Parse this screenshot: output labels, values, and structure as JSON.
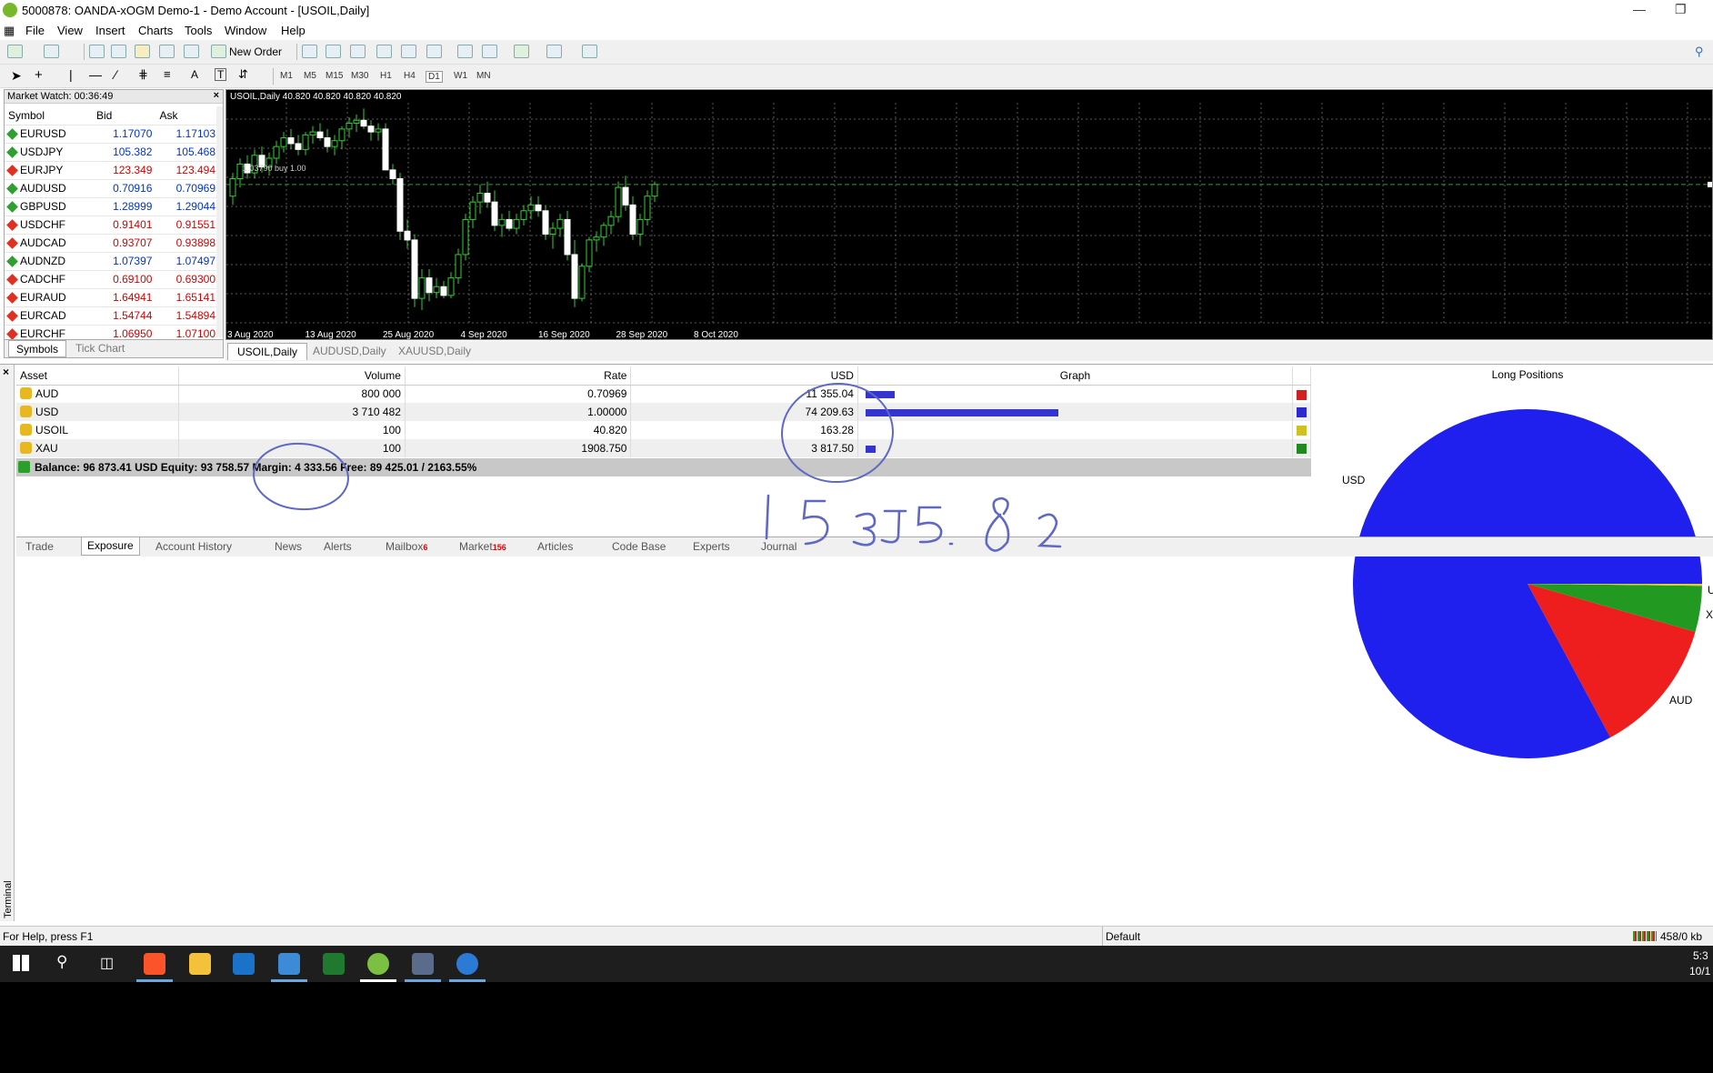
{
  "window": {
    "title": "5000878: OANDA-xOGM Demo-1 - Demo Account - [USOIL,Daily]"
  },
  "menu": [
    "File",
    "View",
    "Insert",
    "Charts",
    "Tools",
    "Window",
    "Help"
  ],
  "toolbar": {
    "new_order": "New Order",
    "timeframes": [
      "M1",
      "M5",
      "M15",
      "M30",
      "H1",
      "H4",
      "D1",
      "W1",
      "MN"
    ]
  },
  "market_watch": {
    "header": "Market Watch: 00:36:49",
    "columns": [
      "Symbol",
      "Bid",
      "Ask"
    ],
    "rows": [
      {
        "symbol": "EURUSD",
        "bid": "1.17070",
        "ask": "1.17103",
        "dir": "up"
      },
      {
        "symbol": "USDJPY",
        "bid": "105.382",
        "ask": "105.468",
        "dir": "up"
      },
      {
        "symbol": "EURJPY",
        "bid": "123.349",
        "ask": "123.494",
        "dir": "down"
      },
      {
        "symbol": "AUDUSD",
        "bid": "0.70916",
        "ask": "0.70969",
        "dir": "up"
      },
      {
        "symbol": "GBPUSD",
        "bid": "1.28999",
        "ask": "1.29044",
        "dir": "up"
      },
      {
        "symbol": "USDCHF",
        "bid": "0.91401",
        "ask": "0.91551",
        "dir": "down"
      },
      {
        "symbol": "AUDCAD",
        "bid": "0.93707",
        "ask": "0.93898",
        "dir": "down"
      },
      {
        "symbol": "AUDNZD",
        "bid": "1.07397",
        "ask": "1.07497",
        "dir": "up"
      },
      {
        "symbol": "CADCHF",
        "bid": "0.69100",
        "ask": "0.69300",
        "dir": "down"
      },
      {
        "symbol": "EURAUD",
        "bid": "1.64941",
        "ask": "1.65141",
        "dir": "down"
      },
      {
        "symbol": "EURCAD",
        "bid": "1.54744",
        "ask": "1.54894",
        "dir": "down"
      },
      {
        "symbol": "EURCHF",
        "bid": "1.06950",
        "ask": "1.07100",
        "dir": "down"
      }
    ],
    "tabs": [
      "Symbols",
      "Tick Chart"
    ]
  },
  "chart": {
    "header": "USOIL,Daily  40.820 40.820 40.820 40.820",
    "trade_label": "1.03790 buy 1.00",
    "dates": [
      "3 Aug 2020",
      "13 Aug 2020",
      "25 Aug 2020",
      "4 Sep 2020",
      "16 Sep 2020",
      "28 Sep 2020",
      "8 Oct 2020"
    ],
    "candles": [
      [
        40.4,
        41.2,
        40.1,
        41.0
      ],
      [
        41.0,
        41.7,
        40.7,
        41.5
      ],
      [
        41.5,
        41.8,
        41.0,
        41.2
      ],
      [
        41.2,
        42.0,
        41.0,
        41.8
      ],
      [
        41.8,
        42.1,
        41.2,
        41.4
      ],
      [
        41.4,
        41.9,
        41.1,
        41.7
      ],
      [
        41.7,
        42.3,
        41.5,
        42.1
      ],
      [
        42.1,
        42.6,
        41.9,
        42.4
      ],
      [
        42.4,
        42.7,
        42.0,
        42.2
      ],
      [
        42.2,
        42.5,
        41.8,
        42.0
      ],
      [
        42.0,
        42.6,
        41.8,
        42.5
      ],
      [
        42.5,
        42.8,
        42.2,
        42.6
      ],
      [
        42.6,
        42.9,
        42.3,
        42.4
      ],
      [
        42.4,
        42.7,
        41.9,
        42.1
      ],
      [
        42.1,
        42.5,
        41.8,
        42.3
      ],
      [
        42.3,
        42.8,
        42.0,
        42.7
      ],
      [
        42.7,
        43.1,
        42.4,
        42.9
      ],
      [
        42.9,
        43.2,
        42.6,
        43.0
      ],
      [
        43.0,
        43.4,
        42.7,
        42.8
      ],
      [
        42.8,
        43.0,
        42.3,
        42.6
      ],
      [
        42.6,
        42.9,
        42.3,
        42.7
      ],
      [
        42.7,
        42.9,
        42.0,
        41.3
      ],
      [
        41.3,
        41.5,
        40.8,
        41.0
      ],
      [
        41.0,
        41.2,
        38.9,
        39.2
      ],
      [
        39.2,
        39.6,
        38.6,
        38.9
      ],
      [
        38.9,
        39.1,
        36.6,
        36.9
      ],
      [
        36.9,
        37.9,
        36.5,
        37.6
      ],
      [
        37.6,
        37.9,
        36.8,
        37.1
      ],
      [
        37.1,
        37.6,
        36.9,
        37.3
      ],
      [
        37.3,
        37.5,
        36.9,
        37.0
      ],
      [
        37.0,
        37.8,
        36.9,
        37.6
      ],
      [
        37.6,
        38.6,
        37.4,
        38.4
      ],
      [
        38.4,
        39.8,
        38.2,
        39.6
      ],
      [
        39.6,
        40.4,
        39.3,
        40.2
      ],
      [
        40.2,
        40.8,
        39.8,
        40.5
      ],
      [
        40.5,
        40.9,
        40.0,
        40.2
      ],
      [
        40.2,
        40.6,
        39.2,
        39.4
      ],
      [
        39.4,
        39.8,
        39.0,
        39.6
      ],
      [
        39.6,
        39.9,
        39.2,
        39.3
      ],
      [
        39.3,
        39.8,
        39.1,
        39.6
      ],
      [
        39.6,
        40.1,
        39.4,
        39.9
      ],
      [
        39.9,
        40.4,
        39.6,
        40.1
      ],
      [
        40.1,
        40.4,
        39.7,
        39.9
      ],
      [
        39.9,
        40.1,
        38.9,
        39.1
      ],
      [
        39.1,
        39.5,
        38.6,
        39.3
      ],
      [
        39.3,
        39.8,
        39.0,
        39.6
      ],
      [
        39.6,
        39.9,
        38.2,
        38.4
      ],
      [
        38.4,
        38.9,
        36.6,
        36.9
      ],
      [
        36.9,
        38.1,
        36.8,
        38.0
      ],
      [
        38.0,
        39.0,
        37.8,
        38.9
      ],
      [
        38.9,
        39.2,
        38.5,
        39.0
      ],
      [
        39.0,
        39.5,
        38.7,
        39.4
      ],
      [
        39.4,
        39.9,
        39.1,
        39.7
      ],
      [
        39.7,
        40.9,
        39.5,
        40.7
      ],
      [
        40.7,
        41.1,
        39.9,
        40.1
      ],
      [
        40.1,
        40.4,
        38.9,
        39.1
      ],
      [
        39.1,
        39.8,
        38.7,
        39.6
      ],
      [
        39.6,
        40.6,
        39.4,
        40.4
      ],
      [
        40.4,
        40.9,
        40.2,
        40.8
      ]
    ]
  },
  "chart_tabs": [
    "USOIL,Daily",
    "AUDUSD,Daily",
    "XAUUSD,Daily"
  ],
  "exposure": {
    "columns": [
      "Asset",
      "Volume",
      "Rate",
      "USD",
      "Graph"
    ],
    "rows": [
      {
        "asset": "AUD",
        "volume": "800 000",
        "rate": "0.70969",
        "usd": "11 355.04",
        "graph": 0.15,
        "color": "#d02020"
      },
      {
        "asset": "USD",
        "volume": "3 710 482",
        "rate": "1.00000",
        "usd": "74 209.63",
        "graph": 1.0,
        "color": "#2a2ad0"
      },
      {
        "asset": "USOIL",
        "volume": "100",
        "rate": "40.820",
        "usd": "163.28",
        "graph": 0.0,
        "color": "#d0c020"
      },
      {
        "asset": "XAU",
        "volume": "100",
        "rate": "1908.750",
        "usd": "3 817.50",
        "graph": 0.05,
        "color": "#208a20"
      }
    ],
    "balance": "Balance: 96 873.41 USD  Equity: 93 758.57  Margin: 4 333.56  Free: 89 425.01 / 2163.55%"
  },
  "long_positions": {
    "title": "Long Positions",
    "slices": [
      {
        "label": "USD",
        "value": 74209.63,
        "color": "#2020ee"
      },
      {
        "label": "AUD",
        "value": 11355.04,
        "color": "#ee1e1e"
      },
      {
        "label": "XAU",
        "value": 3817.5,
        "color": "#229a22"
      },
      {
        "label": "USOIL",
        "value": 163.28,
        "color": "#e0d020"
      }
    ],
    "edge_labels": [
      "U",
      "X"
    ]
  },
  "handwriting": "1 5 3 J 5.8 2",
  "terminal_tabs": [
    {
      "label": "Trade"
    },
    {
      "label": "Exposure",
      "active": true
    },
    {
      "label": "Account History"
    },
    {
      "label": "News"
    },
    {
      "label": "Alerts"
    },
    {
      "label": "Mailbox",
      "badge": "6"
    },
    {
      "label": "Market",
      "badge": "156"
    },
    {
      "label": "Articles"
    },
    {
      "label": "Code Base"
    },
    {
      "label": "Experts"
    },
    {
      "label": "Journal"
    }
  ],
  "terminal_side_label": "Terminal",
  "status": {
    "help": "For Help, press F1",
    "profile": "Default",
    "traffic": "458/0 kb"
  },
  "taskbar": {
    "time": "5:3",
    "date": "10/1"
  }
}
